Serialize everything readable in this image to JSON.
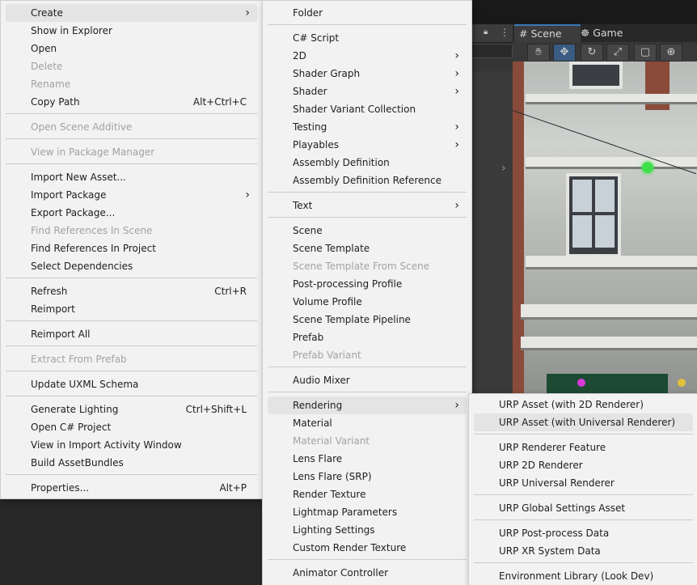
{
  "scene_tabs": {
    "scene": "Scene",
    "game": "Game"
  },
  "scene_tools": [
    "hand-tool",
    "move-tool",
    "rotate-tool",
    "scale-tool",
    "rect-tool",
    "transform-tool"
  ],
  "context_menu": [
    {
      "label": "Create",
      "arrow": true,
      "hl": true
    },
    {
      "label": "Show in Explorer"
    },
    {
      "label": "Open"
    },
    {
      "label": "Delete",
      "disabled": true
    },
    {
      "label": "Rename",
      "disabled": true
    },
    {
      "label": "Copy Path",
      "shortcut": "Alt+Ctrl+C"
    },
    {
      "sep": true
    },
    {
      "label": "Open Scene Additive",
      "disabled": true
    },
    {
      "sep": true
    },
    {
      "label": "View in Package Manager",
      "disabled": true
    },
    {
      "sep": true
    },
    {
      "label": "Import New Asset..."
    },
    {
      "label": "Import Package",
      "arrow": true
    },
    {
      "label": "Export Package..."
    },
    {
      "label": "Find References In Scene",
      "disabled": true
    },
    {
      "label": "Find References In Project"
    },
    {
      "label": "Select Dependencies"
    },
    {
      "sep": true
    },
    {
      "label": "Refresh",
      "shortcut": "Ctrl+R"
    },
    {
      "label": "Reimport"
    },
    {
      "sep": true
    },
    {
      "label": "Reimport All"
    },
    {
      "sep": true
    },
    {
      "label": "Extract From Prefab",
      "disabled": true
    },
    {
      "sep": true
    },
    {
      "label": "Update UXML Schema"
    },
    {
      "sep": true
    },
    {
      "label": "Generate Lighting",
      "shortcut": "Ctrl+Shift+L"
    },
    {
      "label": "Open C# Project"
    },
    {
      "label": "View in Import Activity Window"
    },
    {
      "label": "Build AssetBundles"
    },
    {
      "sep": true
    },
    {
      "label": "Properties...",
      "shortcut": "Alt+P"
    }
  ],
  "create_menu": [
    {
      "label": "Folder"
    },
    {
      "sep": true
    },
    {
      "label": "C# Script"
    },
    {
      "label": "2D",
      "arrow": true
    },
    {
      "label": "Shader Graph",
      "arrow": true
    },
    {
      "label": "Shader",
      "arrow": true
    },
    {
      "label": "Shader Variant Collection"
    },
    {
      "label": "Testing",
      "arrow": true
    },
    {
      "label": "Playables",
      "arrow": true
    },
    {
      "label": "Assembly Definition"
    },
    {
      "label": "Assembly Definition Reference"
    },
    {
      "sep": true
    },
    {
      "label": "Text",
      "arrow": true
    },
    {
      "sep": true
    },
    {
      "label": "Scene"
    },
    {
      "label": "Scene Template"
    },
    {
      "label": "Scene Template From Scene",
      "disabled": true
    },
    {
      "label": "Post-processing Profile"
    },
    {
      "label": "Volume Profile"
    },
    {
      "label": "Scene Template Pipeline"
    },
    {
      "label": "Prefab"
    },
    {
      "label": "Prefab Variant",
      "disabled": true
    },
    {
      "sep": true
    },
    {
      "label": "Audio Mixer"
    },
    {
      "sep": true
    },
    {
      "label": "Rendering",
      "arrow": true,
      "hl": true
    },
    {
      "label": "Material"
    },
    {
      "label": "Material Variant",
      "disabled": true
    },
    {
      "label": "Lens Flare"
    },
    {
      "label": "Lens Flare (SRP)"
    },
    {
      "label": "Render Texture"
    },
    {
      "label": "Lightmap Parameters"
    },
    {
      "label": "Lighting Settings"
    },
    {
      "label": "Custom Render Texture"
    },
    {
      "sep": true
    },
    {
      "label": "Animator Controller"
    }
  ],
  "rendering_menu": [
    {
      "label": "URP Asset (with 2D Renderer)"
    },
    {
      "label": "URP Asset (with Universal Renderer)",
      "hl": true
    },
    {
      "sep": true
    },
    {
      "label": "URP Renderer Feature"
    },
    {
      "label": "URP 2D Renderer"
    },
    {
      "label": "URP Universal Renderer"
    },
    {
      "sep": true
    },
    {
      "label": "URP Global Settings Asset"
    },
    {
      "sep": true
    },
    {
      "label": "URP Post-process Data"
    },
    {
      "label": "URP XR System Data"
    },
    {
      "sep": true
    },
    {
      "label": "Environment Library (Look Dev)"
    }
  ]
}
